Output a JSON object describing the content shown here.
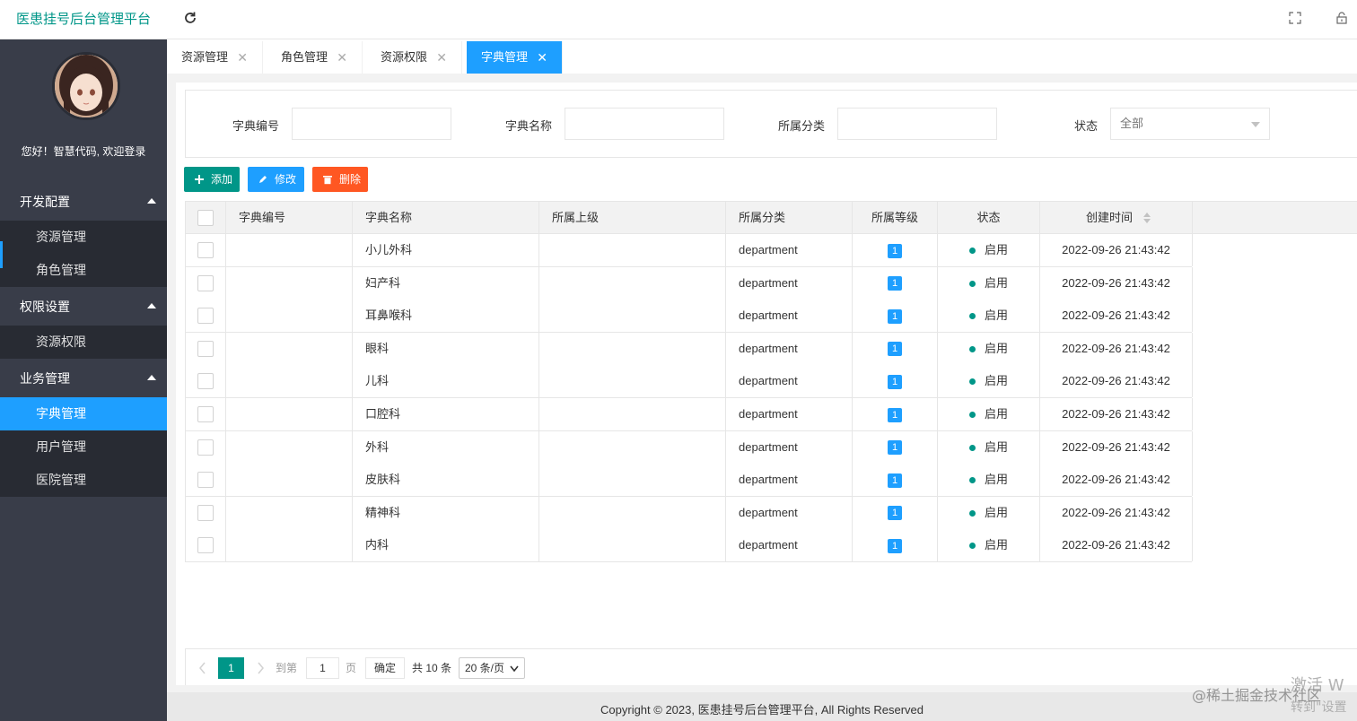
{
  "app": {
    "title": "医患挂号后台管理平台"
  },
  "sidebar": {
    "welcome": "您好！智慧代码, 欢迎登录",
    "groups": [
      {
        "label": "开发配置",
        "items": [
          "资源管理",
          "角色管理"
        ]
      },
      {
        "label": "权限设置",
        "items": [
          "资源权限"
        ]
      },
      {
        "label": "业务管理",
        "items": [
          "字典管理",
          "用户管理",
          "医院管理"
        ]
      }
    ],
    "active_item": "字典管理"
  },
  "tabs": [
    {
      "label": "资源管理"
    },
    {
      "label": "角色管理"
    },
    {
      "label": "资源权限"
    },
    {
      "label": "字典管理",
      "active": true
    }
  ],
  "search": {
    "code_label": "字典编号",
    "name_label": "字典名称",
    "category_label": "所属分类",
    "status_label": "状态",
    "status_value": "全部"
  },
  "toolbar": {
    "add": "添加",
    "edit": "修改",
    "delete": "删除"
  },
  "table": {
    "columns": [
      "字典编号",
      "字典名称",
      "所属上级",
      "所属分类",
      "所属等级",
      "状态",
      "创建时间"
    ],
    "rows": [
      {
        "code": "",
        "name": "小儿外科",
        "parent": "",
        "category": "department",
        "level": "1",
        "status": "启用",
        "created": "2022-09-26 21:43:42"
      },
      {
        "code": "",
        "name": "妇产科",
        "parent": "",
        "category": "department",
        "level": "1",
        "status": "启用",
        "created": "2022-09-26 21:43:42"
      },
      {
        "code": "",
        "name": "耳鼻喉科",
        "parent": "",
        "category": "department",
        "level": "1",
        "status": "启用",
        "created": "2022-09-26 21:43:42"
      },
      {
        "code": "",
        "name": "眼科",
        "parent": "",
        "category": "department",
        "level": "1",
        "status": "启用",
        "created": "2022-09-26 21:43:42"
      },
      {
        "code": "",
        "name": "儿科",
        "parent": "",
        "category": "department",
        "level": "1",
        "status": "启用",
        "created": "2022-09-26 21:43:42"
      },
      {
        "code": "",
        "name": "口腔科",
        "parent": "",
        "category": "department",
        "level": "1",
        "status": "启用",
        "created": "2022-09-26 21:43:42"
      },
      {
        "code": "",
        "name": "外科",
        "parent": "",
        "category": "department",
        "level": "1",
        "status": "启用",
        "created": "2022-09-26 21:43:42"
      },
      {
        "code": "",
        "name": "皮肤科",
        "parent": "",
        "category": "department",
        "level": "1",
        "status": "启用",
        "created": "2022-09-26 21:43:42"
      },
      {
        "code": "",
        "name": "精神科",
        "parent": "",
        "category": "department",
        "level": "1",
        "status": "启用",
        "created": "2022-09-26 21:43:42"
      },
      {
        "code": "",
        "name": "内科",
        "parent": "",
        "category": "department",
        "level": "1",
        "status": "启用",
        "created": "2022-09-26 21:43:42"
      }
    ]
  },
  "pagination": {
    "current_page": "1",
    "goto_label": "到第",
    "goto_value": "1",
    "page_unit": "页",
    "confirm": "确定",
    "total": "共 10 条",
    "page_size": "20 条/页"
  },
  "footer": {
    "copyright": "Copyright © 2023, 医患挂号后台管理平台, All Rights Reserved"
  },
  "watermarks": {
    "activate_line1": "激活 W",
    "activate_line2": "转到\"设置",
    "community": "@稀土掘金技术社区"
  },
  "colors": {
    "accent": "#009688",
    "blue": "#1e9fff",
    "danger": "#ff5722",
    "sidebar": "#393d49"
  },
  "icons": [
    "refresh-icon",
    "fullscreen-icon",
    "lock-icon",
    "plus-icon",
    "edit-icon",
    "trash-icon",
    "sort-icon",
    "chevron-left-icon",
    "chevron-right-icon",
    "close-icon",
    "caret-up-icon"
  ]
}
